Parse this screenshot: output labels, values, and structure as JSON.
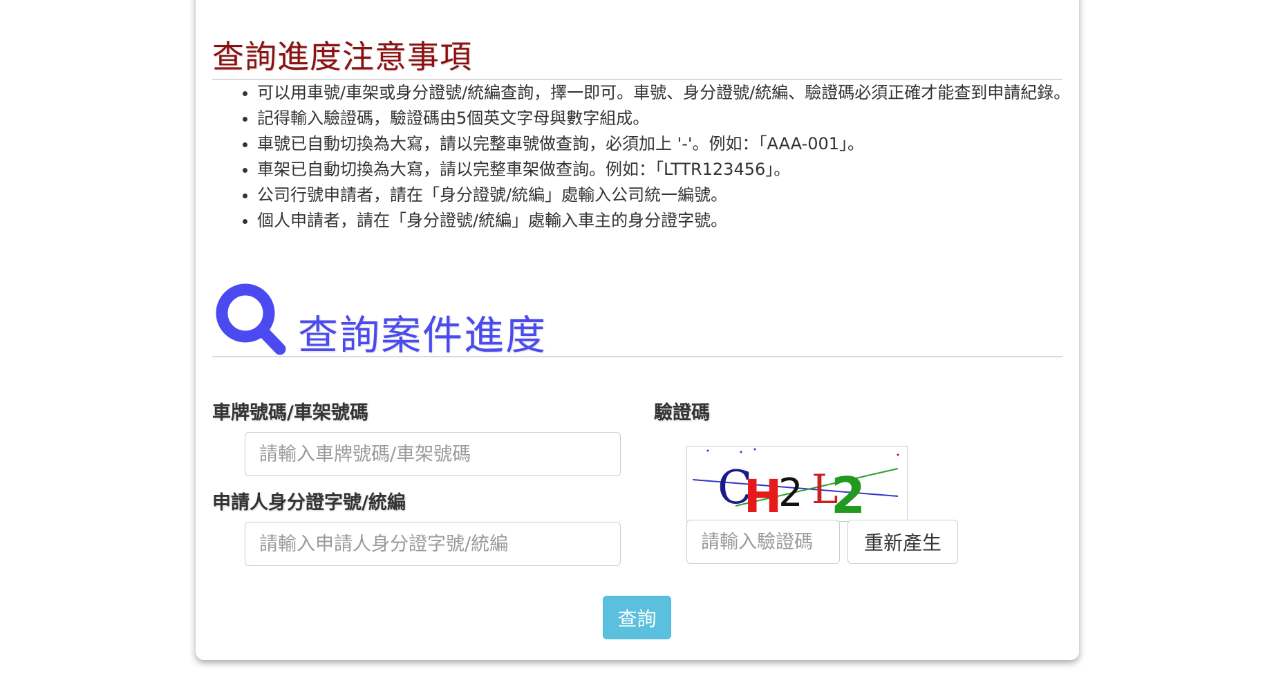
{
  "notice": {
    "title": "查詢進度注意事項",
    "items": [
      "可以用車號/車架或身分證號/統編查詢，擇一即可。車號、身分證號/統編、驗證碼必須正確才能查到申請紀錄。",
      "記得輸入驗證碼，驗證碼由5個英文字母與數字組成。",
      "車號已自動切換為大寫，請以完整車號做查詢，必須加上 '-'。例如：「AAA-001」。",
      "車架已自動切換為大寫，請以完整車架做查詢。例如：「LTTR123456」。",
      "公司行號申請者，請在「身分證號/統編」處輸入公司統一編號。",
      "個人申請者，請在「身分證號/統編」處輸入車主的身分證字號。"
    ]
  },
  "search": {
    "title": "查詢案件進度",
    "icon": "search-icon",
    "icon_color": "#4a4af0"
  },
  "form": {
    "plate_label": "車牌號碼/車架號碼",
    "plate_placeholder": "請輸入車牌號碼/車架號碼",
    "id_label": "申請人身分證字號/統編",
    "id_placeholder": "請輸入申請人身分證字號/統編",
    "captcha_label": "驗證碼",
    "captcha_text": "CH2L2",
    "captcha_placeholder": "請輸入驗證碼",
    "regenerate_label": "重新產生",
    "submit_label": "查詢"
  },
  "colors": {
    "notice_title": "#8b1010",
    "search_title": "#4a4af0",
    "submit_button": "#5bc0de"
  }
}
